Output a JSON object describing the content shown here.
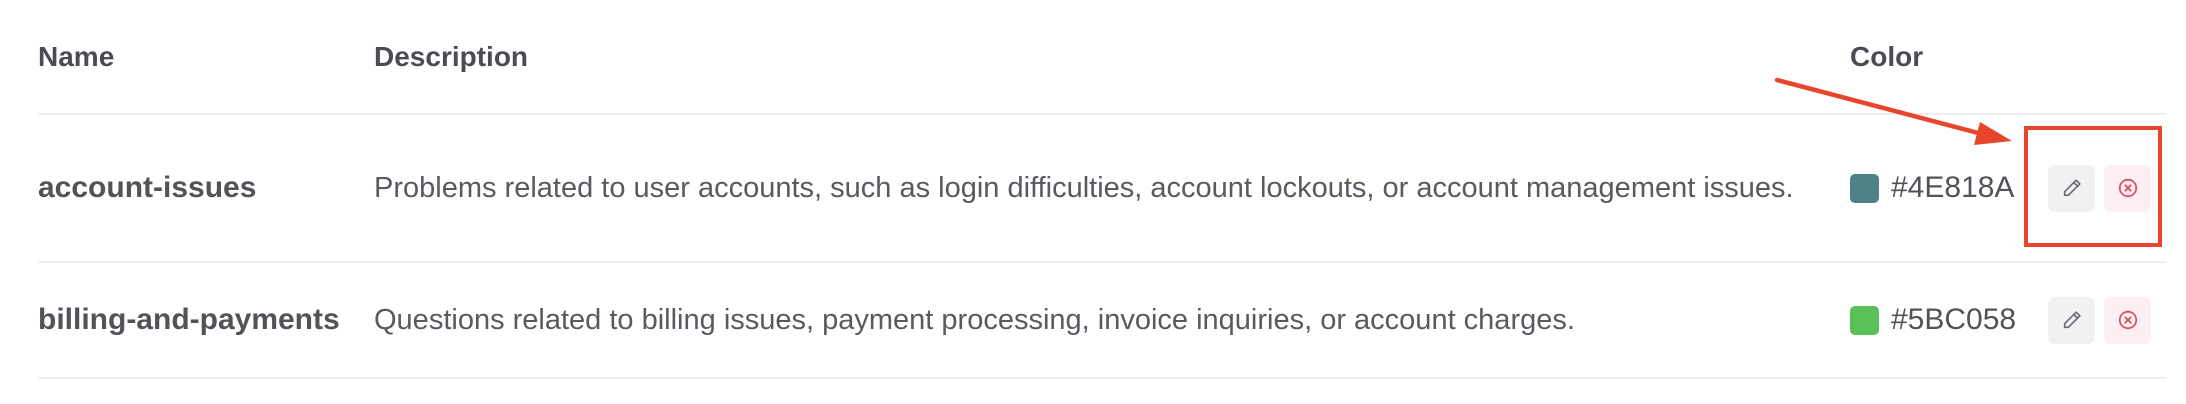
{
  "columns": {
    "name": "Name",
    "description": "Description",
    "color": "Color"
  },
  "rows": [
    {
      "name": "account-issues",
      "description": "Problems related to user accounts, such as login difficulties, account lockouts, or account management issues.",
      "color_hex": "#4E818A",
      "swatch_color": "#4E818A"
    },
    {
      "name": "billing-and-payments",
      "description": "Questions related to billing issues, payment processing, invoice inquiries, or account charges.",
      "color_hex": "#5BC058",
      "swatch_color": "#5BC058"
    }
  ],
  "icons": {
    "edit": "pencil-icon",
    "delete": "close-circle-icon"
  },
  "colors": {
    "annotation": "#E8452C",
    "delete_icon": "#D9485F",
    "edit_icon": "#6B6B75"
  }
}
